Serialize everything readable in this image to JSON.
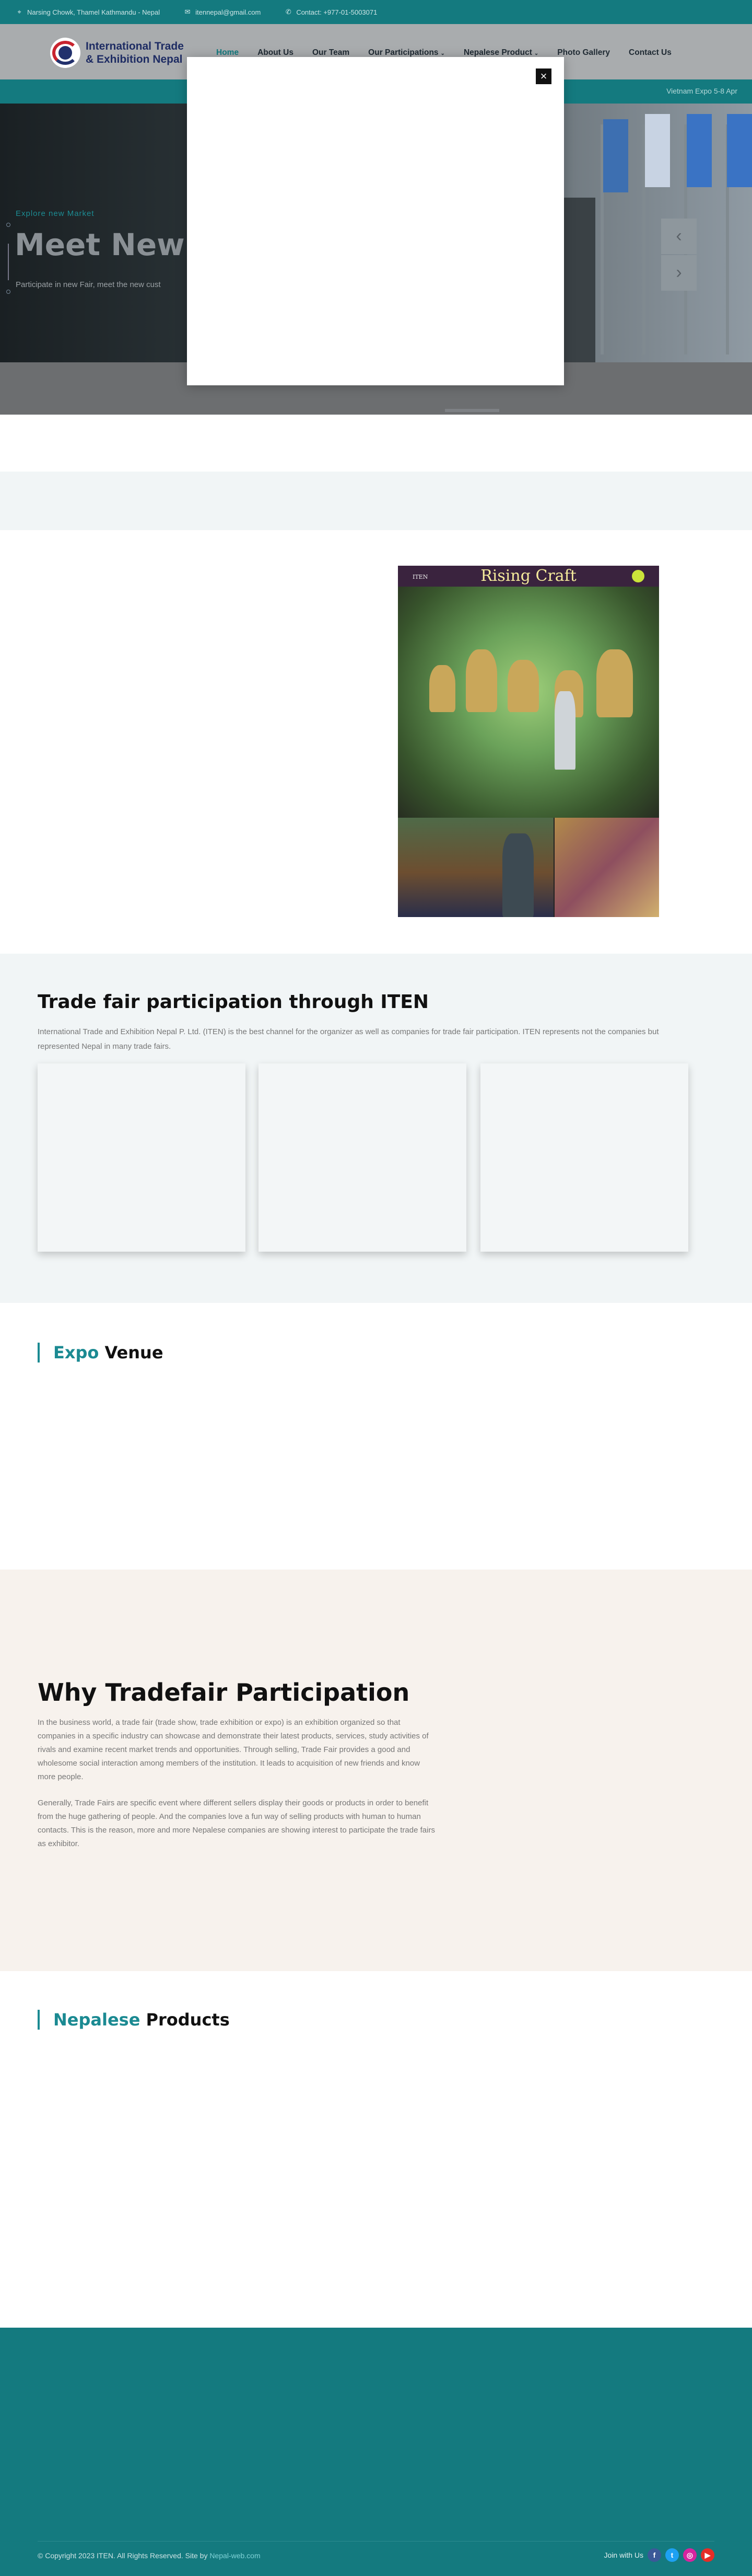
{
  "topbar": {
    "address": "Narsing Chowk, Thamel Kathmandu - Nepal",
    "email": "itennepal@gmail.com",
    "phone": "Contact: +977-01-5003071",
    "icons": {
      "address": "map-pin-icon",
      "email": "envelope-icon",
      "phone": "phone-icon"
    }
  },
  "header": {
    "logo_line1": "International Trade",
    "logo_line2": "& Exhibition Nepal",
    "nav": [
      {
        "label": "Home",
        "active": true
      },
      {
        "label": "About Us"
      },
      {
        "label": "Our Team"
      },
      {
        "label": "Our Participations",
        "dropdown": true
      },
      {
        "label": "Nepalese Product",
        "dropdown": true
      },
      {
        "label": "Photo Gallery"
      },
      {
        "label": "Contact Us"
      }
    ],
    "dropdown_caret": "⌄",
    "ticker": "Vietnam Expo 5-8 Apr"
  },
  "hero": {
    "eyebrow": "Explore new Market",
    "title": "Meet New",
    "subtitle": "Participate in new Fair, meet the new cust",
    "prev_icon": "‹",
    "next_icon": "›"
  },
  "modal": {
    "close_icon": "×"
  },
  "about_photo": {
    "banner_text": "Rising  Craft",
    "tag": "ITEN"
  },
  "trade_fair": {
    "title": "Trade fair participation through ITEN",
    "description": "International Trade and Exhibition Nepal P. Ltd. (ITEN) is the best channel for the organizer as well as companies for trade fair participation. ITEN represents not the companies but represented Nepal in many trade fairs."
  },
  "expo_venue": {
    "accent": "Expo",
    "rest": " Venue"
  },
  "why": {
    "title": "Why Tradefair Participation",
    "para1": "In the business world, a trade fair (trade show, trade exhibition or expo) is an exhibition organized so that companies in a specific industry can showcase and demonstrate their latest products, services, study activities of rivals and examine recent market trends and opportunities. Through selling, Trade Fair provides a good and wholesome social interaction among members of the institution. It leads to acquisition of new friends and know more people.",
    "para2": "Generally, Trade Fairs are specific event where different sellers display their goods or products in order to benefit from the huge gathering of people. And the companies love a fun way of selling products with human to human contacts. This is the reason, more and more Nepalese companies are showing interest to participate the trade fairs as exhibitor."
  },
  "products": {
    "accent": "Nepalese",
    "rest": " Products"
  },
  "footer": {
    "copyright": "© Copyright 2023 ITEN. All Rights Reserved. Site by ",
    "site_by": "Nepal-web.com",
    "join": "Join with Us",
    "social": [
      {
        "name": "facebook-icon",
        "glyph": "f",
        "color": "#3b5998"
      },
      {
        "name": "twitter-icon",
        "glyph": "t",
        "color": "#1da1f2"
      },
      {
        "name": "instagram-icon",
        "glyph": "◎",
        "color": "#d6249f"
      },
      {
        "name": "youtube-icon",
        "glyph": "▶",
        "color": "#e52d27"
      }
    ]
  }
}
